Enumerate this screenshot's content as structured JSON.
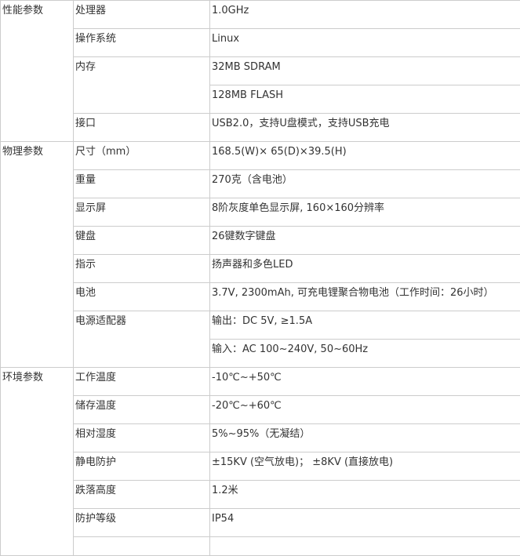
{
  "table": {
    "groups": [
      {
        "category": "性能参数",
        "items": [
          {
            "name": "处理器",
            "values": [
              "1.0GHz"
            ]
          },
          {
            "name": "操作系统",
            "values": [
              "Linux"
            ]
          },
          {
            "name": "内存",
            "values": [
              "32MB SDRAM",
              "128MB FLASH"
            ]
          },
          {
            "name": "接口",
            "values": [
              "USB2.0，支持U盘模式，支持USB充电"
            ]
          }
        ]
      },
      {
        "category": "物理参数",
        "items": [
          {
            "name": "尺寸（mm）",
            "values": [
              "168.5(W)× 65(D)×39.5(H)"
            ]
          },
          {
            "name": "重量",
            "values": [
              "270克（含电池）"
            ]
          },
          {
            "name": "显示屏",
            "values": [
              "8阶灰度单色显示屏, 160×160分辨率"
            ]
          },
          {
            "name": "键盘",
            "values": [
              "26键数字键盘"
            ]
          },
          {
            "name": "指示",
            "values": [
              "扬声器和多色LED"
            ]
          },
          {
            "name": "电池",
            "values": [
              "3.7V, 2300mAh, 可充电锂聚合物电池（工作时间：26小时）"
            ]
          },
          {
            "name": "电源适配器",
            "values": [
              "输出：DC 5V, ≥1.5A",
              "输入：AC 100~240V, 50~60Hz"
            ]
          }
        ]
      },
      {
        "category": "环境参数",
        "items": [
          {
            "name": "工作温度",
            "values": [
              "-10℃~+50℃"
            ]
          },
          {
            "name": "储存温度",
            "values": [
              "-20℃~+60℃"
            ]
          },
          {
            "name": "相对湿度",
            "values": [
              "5%~95%（无凝结）"
            ]
          },
          {
            "name": "静电防护",
            "values": [
              "±15KV (空气放电)； ±8KV (直接放电)"
            ]
          },
          {
            "name": "跌落高度",
            "values": [
              "1.2米"
            ]
          },
          {
            "name": "防护等级",
            "values": [
              "IP54"
            ]
          }
        ]
      }
    ]
  }
}
